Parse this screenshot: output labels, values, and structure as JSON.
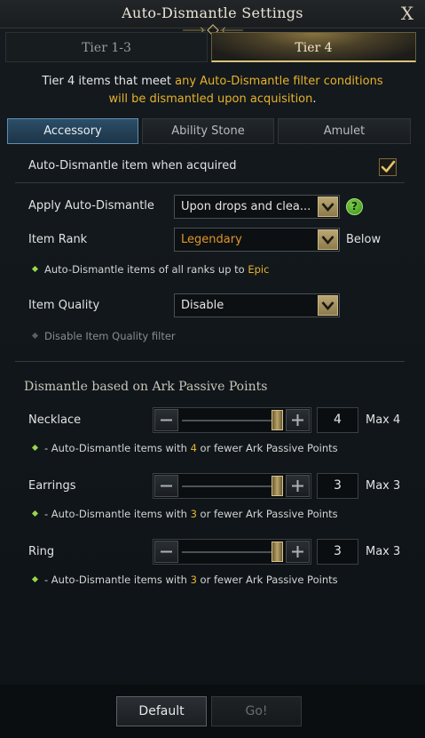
{
  "window": {
    "title": "Auto-Dismantle Settings",
    "close_label": "X"
  },
  "tiers": [
    {
      "label": "Tier 1-3",
      "active": false
    },
    {
      "label": "Tier 4",
      "active": true
    }
  ],
  "description": {
    "part1": "Tier 4 items that meet ",
    "highlight": "any Auto-Dismantle filter conditions",
    "part2": "will be dismantled upon acquisition",
    "end": "."
  },
  "subtabs": [
    {
      "label": "Accessory",
      "active": true
    },
    {
      "label": "Ability Stone",
      "active": false
    },
    {
      "label": "Amulet",
      "active": false
    }
  ],
  "auto_when_acquired": {
    "label": "Auto-Dismantle item when acquired",
    "checked": true
  },
  "apply": {
    "label": "Apply Auto-Dismantle",
    "value": "Upon drops and clea...",
    "help": "?"
  },
  "rank": {
    "label": "Item Rank",
    "value": "Legendary",
    "value_color": "#e0962a",
    "suffix": "Below",
    "note_text": "Auto-Dismantle items of all ranks up to ",
    "note_highlight": "Epic"
  },
  "quality": {
    "label": "Item Quality",
    "value": "Disable",
    "note": "Disable Item Quality filter"
  },
  "ark_section": {
    "title": "Dismantle based on Ark Passive Points"
  },
  "ark_items": [
    {
      "label": "Necklace",
      "value": "4",
      "max_label": "Max 4",
      "max": 4,
      "note_pre": "- Auto-Dismantle items with ",
      "note_value": "4",
      "note_post": " or fewer Ark Passive Points"
    },
    {
      "label": "Earrings",
      "value": "3",
      "max_label": "Max 3",
      "max": 3,
      "note_pre": "- Auto-Dismantle items with ",
      "note_value": "3",
      "note_post": " or fewer Ark Passive Points"
    },
    {
      "label": "Ring",
      "value": "3",
      "max_label": "Max 3",
      "max": 3,
      "note_pre": "- Auto-Dismantle items with ",
      "note_value": "3",
      "note_post": " or fewer Ark Passive Points"
    }
  ],
  "footer": {
    "default_label": "Default",
    "go_label": "Go!"
  },
  "colors": {
    "accent_gold": "#e8b22a",
    "active_tab_blue": "#2c4f68",
    "bullet_green": "#9bd64a"
  },
  "icons": {
    "close": "close-icon",
    "check": "checkmark-icon",
    "dropdown": "chevron-down-icon",
    "help": "help-icon",
    "minus": "minus-icon",
    "plus": "plus-icon"
  }
}
